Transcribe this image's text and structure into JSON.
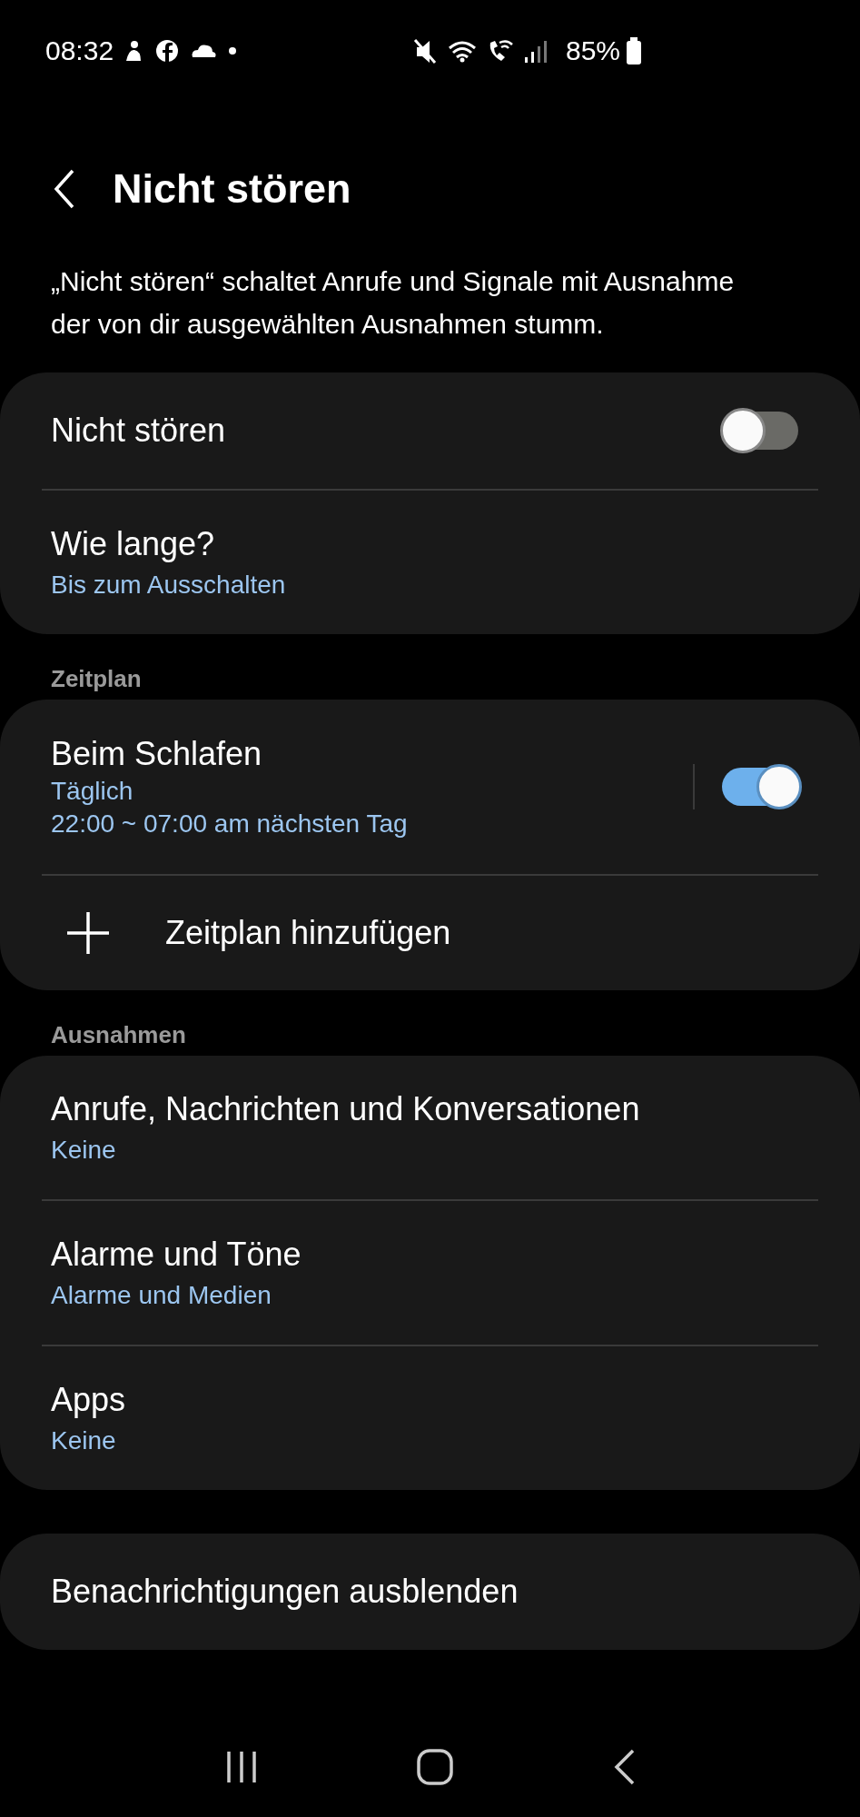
{
  "status_bar": {
    "time": "08:32",
    "battery": "85%"
  },
  "header": {
    "title": "Nicht stören"
  },
  "description": "„Nicht stören“ schaltet Anrufe und Signale mit Ausnahme der von dir ausgewählten Ausnahmen stumm.",
  "sections": [
    {
      "items": [
        {
          "kind": "toggle",
          "title": "Nicht stören",
          "on": false
        },
        {
          "kind": "link",
          "title": "Wie lange?",
          "subtitle": "Bis zum Ausschalten"
        }
      ]
    },
    {
      "heading": "Zeitplan",
      "items": [
        {
          "kind": "schedule",
          "title": "Beim Schlafen",
          "lines": [
            "Täglich",
            "22:00 ~ 07:00 am nächsten Tag"
          ],
          "on": true
        },
        {
          "kind": "add",
          "title": "Zeitplan hinzufügen"
        }
      ]
    },
    {
      "heading": "Ausnahmen",
      "items": [
        {
          "kind": "link",
          "title": "Anrufe, Nachrichten und Konversationen",
          "subtitle": "Keine"
        },
        {
          "kind": "link",
          "title": "Alarme und Töne",
          "subtitle": "Alarme und Medien"
        },
        {
          "kind": "link",
          "title": "Apps",
          "subtitle": "Keine"
        }
      ]
    },
    {
      "items": [
        {
          "kind": "plain",
          "title": "Benachrichtigungen ausblenden"
        }
      ]
    }
  ]
}
